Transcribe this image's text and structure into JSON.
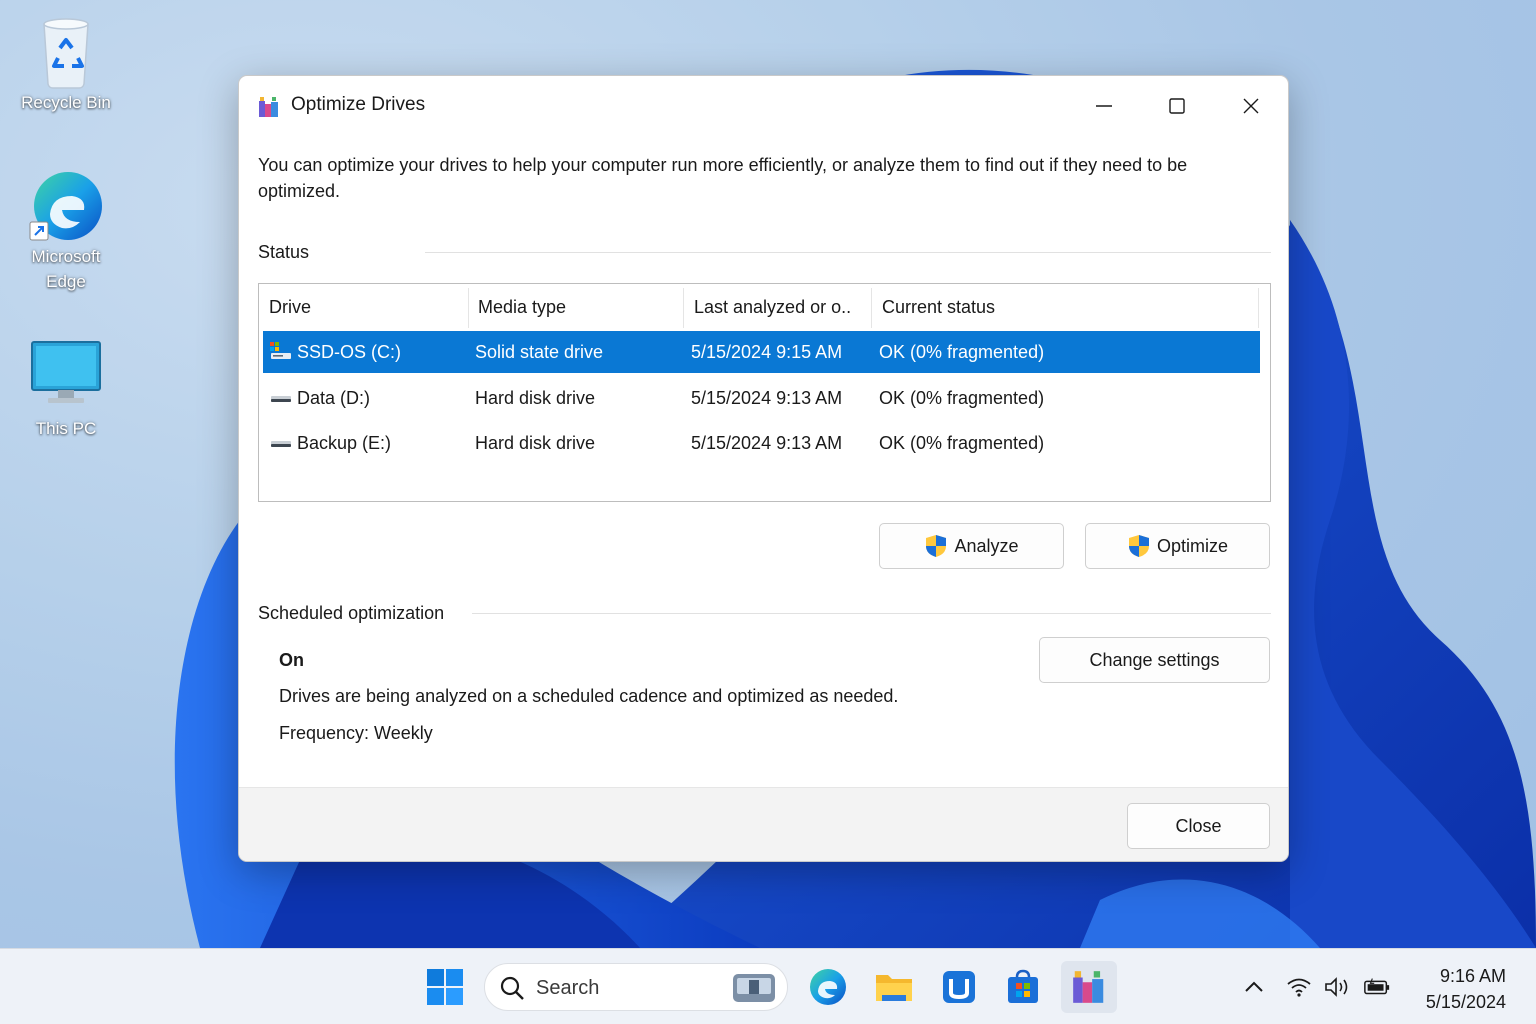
{
  "desktop": {
    "icons": [
      {
        "label": "Recycle Bin"
      },
      {
        "label": "Microsoft Edge"
      },
      {
        "label": "This PC"
      }
    ]
  },
  "window": {
    "title": "Optimize Drives",
    "description": "You can optimize your drives to help your computer run more efficiently, or analyze them to find out if they need to be optimized.",
    "status_label": "Status",
    "columns": [
      "Drive",
      "Media type",
      "Last analyzed or o..",
      "Current status"
    ],
    "drives": [
      {
        "name": "SSD-OS (C:)",
        "media": "Solid state drive",
        "last": "5/15/2024 9:15 AM",
        "status": "OK (0% fragmented)",
        "selected": true
      },
      {
        "name": "Data (D:)",
        "media": "Hard disk drive",
        "last": "5/15/2024 9:13 AM",
        "status": "OK (0% fragmented)",
        "selected": false
      },
      {
        "name": "Backup (E:)",
        "media": "Hard disk drive",
        "last": "5/15/2024 9:13 AM",
        "status": "OK (0% fragmented)",
        "selected": false
      }
    ],
    "analyze_label": "Analyze",
    "optimize_label": "Optimize",
    "scheduled_label": "Scheduled optimization",
    "scheduled_state": "On",
    "scheduled_desc": "Drives are being analyzed on a scheduled cadence and optimized as needed.",
    "frequency": "Frequency: Weekly",
    "change_settings_label": "Change settings",
    "close_label": "Close"
  },
  "taskbar": {
    "search_placeholder": "Search",
    "time": "9:16 AM",
    "date": "5/15/2024"
  },
  "colors": {
    "selection": "#0a78d4",
    "accent": "#0067c0"
  }
}
